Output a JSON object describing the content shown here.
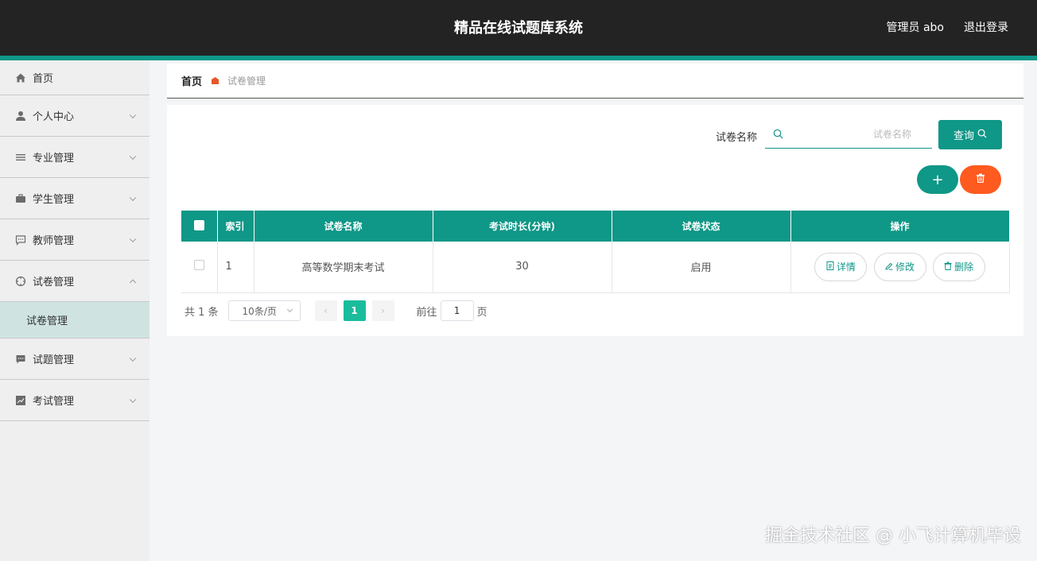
{
  "header": {
    "title": "精品在线试题库系统",
    "user": "管理员 abo",
    "logout": "退出登录"
  },
  "sidebar": {
    "items": [
      {
        "label": "首页",
        "icon": "home-icon"
      },
      {
        "label": "个人中心",
        "icon": "user-icon"
      },
      {
        "label": "专业管理",
        "icon": "list-icon"
      },
      {
        "label": "学生管理",
        "icon": "briefcase-icon"
      },
      {
        "label": "教师管理",
        "icon": "chat-icon"
      },
      {
        "label": "试卷管理",
        "icon": "compass-icon",
        "expanded": true,
        "sub": "试卷管理"
      },
      {
        "label": "试题管理",
        "icon": "message-icon"
      },
      {
        "label": "考试管理",
        "icon": "chart-icon"
      }
    ]
  },
  "breadcrumb": {
    "home": "首页",
    "current": "试卷管理"
  },
  "search": {
    "label": "试卷名称",
    "placeholder": "试卷名称",
    "value": "",
    "button": "查询"
  },
  "actions": {
    "add": "+"
  },
  "table": {
    "headers": [
      "索引",
      "试卷名称",
      "考试时长(分钟)",
      "试卷状态",
      "操作"
    ],
    "rows": [
      {
        "index": "1",
        "name": "高等数学期末考试",
        "duration": "30",
        "status": "启用"
      }
    ],
    "ops": {
      "detail": "详情",
      "edit": "修改",
      "delete": "删除"
    }
  },
  "pagination": {
    "total": "共 1 条",
    "page_size": "10条/页",
    "current": "1",
    "goto_label": "前往",
    "goto_value": "1",
    "page_suffix": "页"
  },
  "watermark": "掘金技术社区 @ 小飞计算机毕设",
  "colors": {
    "primary": "#0f9787",
    "danger": "#ff5a1f",
    "header_bg": "#232323",
    "sidebar_bg": "#efefef",
    "active_sub_bg": "#cfe4e1"
  }
}
